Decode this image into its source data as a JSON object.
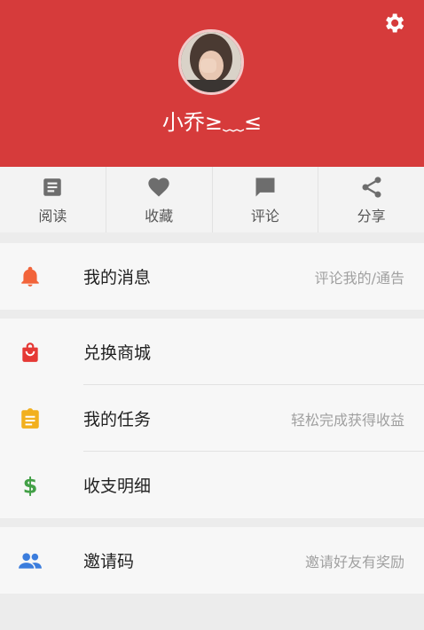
{
  "profile": {
    "username": "小乔≥﹏≤"
  },
  "tabs": [
    {
      "label": "阅读",
      "icon": "article-icon"
    },
    {
      "label": "收藏",
      "icon": "heart-icon"
    },
    {
      "label": "评论",
      "icon": "comment-icon"
    },
    {
      "label": "分享",
      "icon": "share-icon"
    }
  ],
  "menu": {
    "messages": {
      "title": "我的消息",
      "hint": "评论我的/通告",
      "icon": "bell-icon",
      "color": "#f2643a"
    },
    "exchange": {
      "title": "兑换商城",
      "icon": "shopping-bag-icon",
      "color": "#e53935"
    },
    "tasks": {
      "title": "我的任务",
      "hint": "轻松完成获得收益",
      "icon": "clipboard-icon",
      "color": "#f2b01e"
    },
    "income": {
      "title": "收支明细",
      "icon": "dollar-icon",
      "color": "#43a047"
    },
    "invite": {
      "title": "邀请码",
      "hint": "邀请好友有奖励",
      "icon": "people-icon",
      "color": "#3b7ddd"
    }
  },
  "colors": {
    "header_bg": "#d63b3b"
  }
}
